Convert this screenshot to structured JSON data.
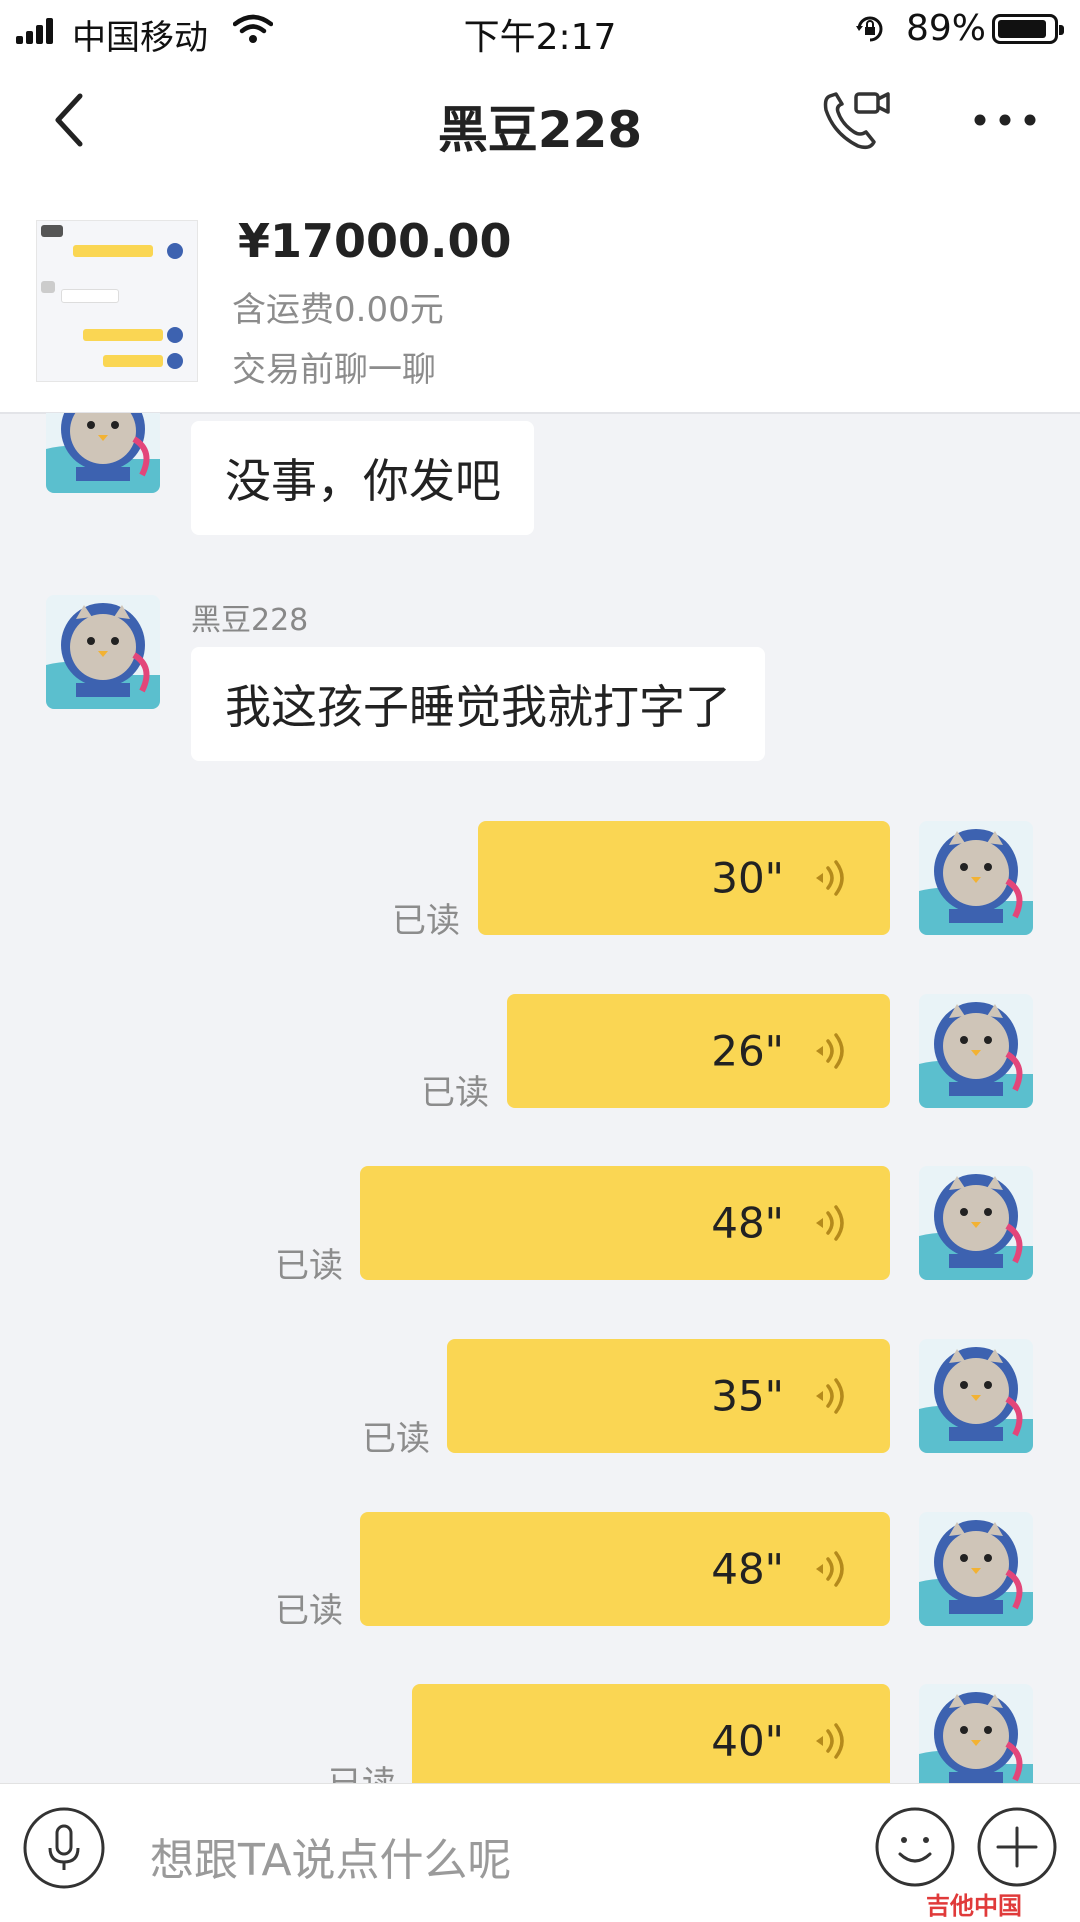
{
  "status_bar": {
    "carrier": "中国移动",
    "time": "下午2:17",
    "battery": "89%",
    "battery_level": 0.89
  },
  "nav": {
    "title": "黑豆228",
    "back_icon": "chevron-left-icon",
    "call_icon": "phone-video-icon",
    "more_icon": "more-dots-icon"
  },
  "product": {
    "price": "¥17000.00",
    "shipping": "含运费0.00元",
    "prechat": "交易前聊一聊"
  },
  "messages": {
    "in1": {
      "text": "没事，你发吧"
    },
    "in2": {
      "sender": "黑豆228",
      "text": "我这孩子睡觉我就打字了"
    },
    "out": [
      {
        "duration": "30\"",
        "status": "已读"
      },
      {
        "duration": "26\"",
        "status": "已读"
      },
      {
        "duration": "48\"",
        "status": "已读"
      },
      {
        "duration": "35\"",
        "status": "已读"
      },
      {
        "duration": "48\"",
        "status": "已读"
      },
      {
        "duration": "40\"",
        "status": "已读"
      }
    ]
  },
  "input": {
    "placeholder": "想跟TA说点什么呢"
  },
  "colors": {
    "voice_bubble": "#fad653",
    "background": "#f2f3f6",
    "avatar_blue": "#3d62b0"
  },
  "watermark": "吉他中国"
}
